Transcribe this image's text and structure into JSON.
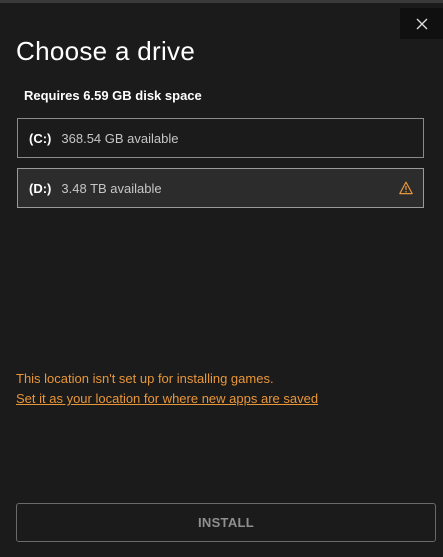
{
  "dialog": {
    "title": "Choose a drive",
    "requirement": "Requires 6.59 GB disk space",
    "close_icon": "close-icon"
  },
  "drives": [
    {
      "letter": "(C:)",
      "space": "368.54 GB available",
      "selected": false,
      "warning": false
    },
    {
      "letter": "(D:)",
      "space": "3.48 TB available",
      "selected": true,
      "warning": true,
      "warning_icon": "warning-triangle-icon"
    }
  ],
  "warning": {
    "message": "This location isn't set up for installing games.",
    "link": "Set it as your location for where new apps are saved"
  },
  "actions": {
    "install_label": "INSTALL",
    "install_enabled": false
  },
  "colors": {
    "background": "#1b1b1b",
    "warning": "#e8963a",
    "selected_row": "#2c2c2c",
    "border": "#8a8a8a",
    "disabled_text": "#8f8f8f"
  }
}
